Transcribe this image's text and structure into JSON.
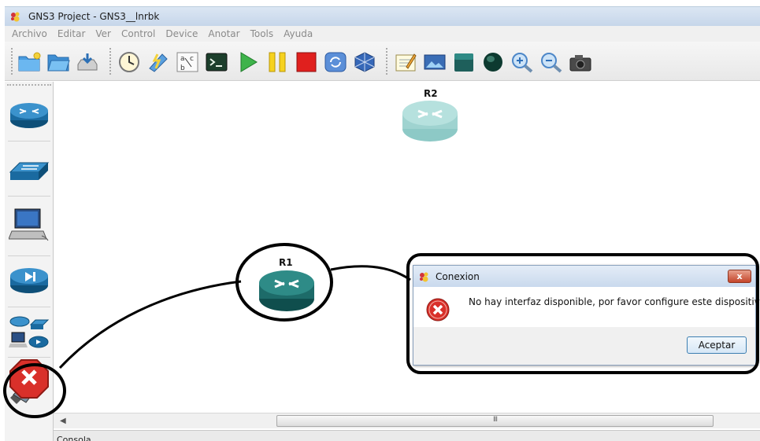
{
  "window": {
    "title": "GNS3 Project - GNS3__lnrbk"
  },
  "menu": {
    "items": [
      "Archivo",
      "Editar",
      "Ver",
      "Control",
      "Device",
      "Anotar",
      "Tools",
      "Ayuda"
    ]
  },
  "toolbar": {
    "buttons": [
      {
        "icon": "new-project-icon"
      },
      {
        "icon": "open-project-icon"
      },
      {
        "icon": "save-project-icon"
      },
      {
        "icon": "snapshot-clock-icon"
      },
      {
        "icon": "idle-pc-icon"
      },
      {
        "icon": "show-interface-labels-icon"
      },
      {
        "icon": "console-icon"
      },
      {
        "icon": "start-icon"
      },
      {
        "icon": "suspend-icon"
      },
      {
        "icon": "stop-icon"
      },
      {
        "icon": "reload-icon"
      },
      {
        "icon": "virtualbox-icon"
      },
      {
        "icon": "add-note-icon"
      },
      {
        "icon": "insert-image-icon"
      },
      {
        "icon": "draw-rectangle-icon"
      },
      {
        "icon": "draw-ellipse-icon"
      },
      {
        "icon": "zoom-in-icon"
      },
      {
        "icon": "zoom-out-icon"
      },
      {
        "icon": "screenshot-icon"
      }
    ]
  },
  "device_panel": {
    "items": [
      {
        "icon": "router-icon"
      },
      {
        "icon": "switch-icon"
      },
      {
        "icon": "end-device-icon"
      },
      {
        "icon": "security-device-icon"
      },
      {
        "icon": "all-devices-icon"
      },
      {
        "icon": "cancel-link-icon"
      }
    ]
  },
  "topology": {
    "nodes": [
      {
        "id": "R2",
        "label": "R2"
      },
      {
        "id": "R1",
        "label": "R1"
      }
    ]
  },
  "scrollbar": {
    "thumb_grip": "III"
  },
  "console": {
    "label": "Consola"
  },
  "dialog": {
    "title": "Conexion",
    "close_label": "x",
    "message": "No hay interfaz disponible, por favor configure este dispositivo",
    "ok_label": "Aceptar"
  },
  "colors": {
    "router_body": "#4aa3a0",
    "router_dark": "#1f5e5c",
    "annotation_outline": "#000000",
    "error_red": "#d9302a"
  }
}
